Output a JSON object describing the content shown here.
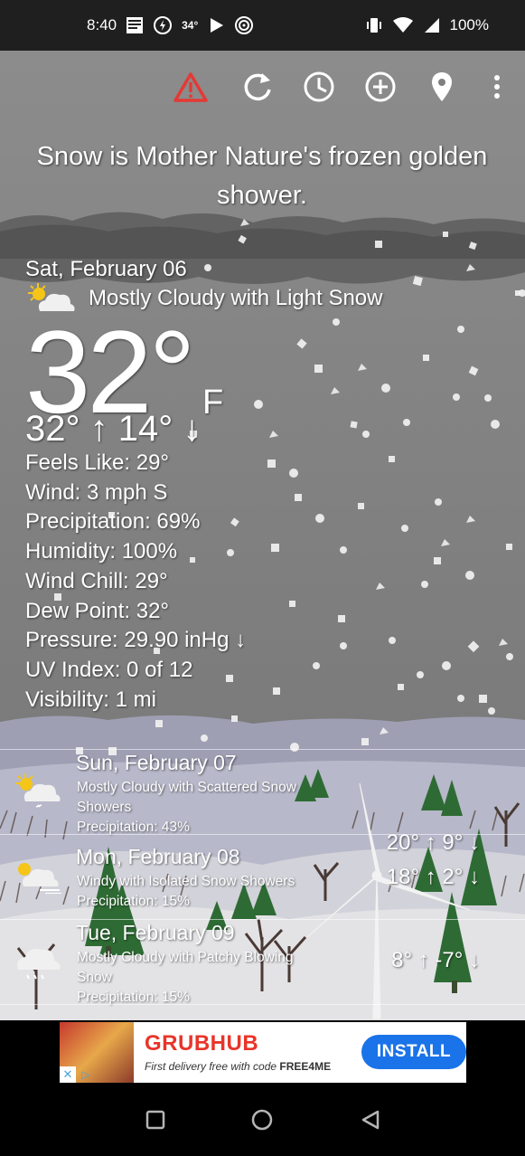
{
  "status_bar": {
    "time": "8:40",
    "temp_badge": "34°",
    "battery": "100%",
    "icons": [
      "weather-channel-icon",
      "alert-circle-icon",
      "play-store-icon",
      "target-icon",
      "vibrate-icon",
      "wifi-icon",
      "signal-icon"
    ]
  },
  "toolbar": {
    "icons": [
      "warning-icon",
      "refresh-icon",
      "clock-icon",
      "add-location-icon",
      "location-pin-icon",
      "more-vert-icon"
    ],
    "alert_color": "#e53935"
  },
  "quote": "Snow is Mother Nature's frozen golden shower.",
  "today": {
    "date": "Sat, February 06",
    "condition": "Mostly Cloudy with Light Snow",
    "icon": "partly-cloudy-snow-icon",
    "temperature": "32°",
    "unit": "F",
    "hi_lo": "32° ↑ 14° ↓",
    "details": {
      "feels_like": "Feels Like: 29°",
      "wind": "Wind: 3 mph S",
      "precipitation": "Precipitation: 69%",
      "humidity": "Humidity: 100%",
      "wind_chill": "Wind Chill: 29°",
      "dew_point": "Dew Point: 32°",
      "pressure": "Pressure: 29.90 inHg ↓",
      "uv_index": "UV Index: 0 of 12",
      "visibility": "Visibility: 1 mi"
    }
  },
  "forecast": [
    {
      "date": "Sun, February 07",
      "desc": "Mostly Cloudy with Scattered Snow Showers",
      "precip": "Precipitation: 43%",
      "temps": "20° ↑ 9° ↓",
      "icon": "partly-cloudy-snow-icon"
    },
    {
      "date": "Mon, February 08",
      "desc": "Windy with Isolated Snow Showers",
      "precip": "Precipitation: 15%",
      "temps": "18° ↑ 2° ↓",
      "icon": "windy-snow-icon"
    },
    {
      "date": "Tue, February 09",
      "desc": "Mostly Cloudy with Patchy Blowing Snow",
      "precip": "Precipitation: 15%",
      "temps": "8° ↑ -7° ↓",
      "icon": "cloudy-snow-icon"
    }
  ],
  "ad": {
    "brand": "GRUBHUB",
    "text_prefix": "First delivery free with code ",
    "code": "FREE4ME",
    "cta": "INSTALL",
    "close": "✕",
    "info": "▷",
    "brand_color": "#e8352a",
    "cta_color": "#1a73e8"
  },
  "nav": {
    "icons": [
      "recents-square-icon",
      "home-circle-icon",
      "back-triangle-icon"
    ]
  }
}
